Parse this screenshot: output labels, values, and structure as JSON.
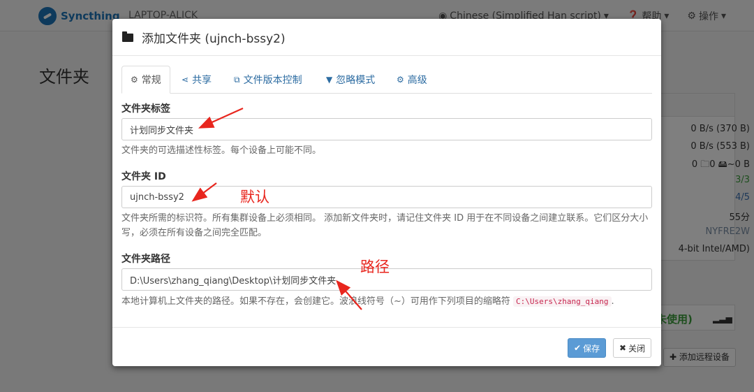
{
  "app": {
    "brand": "Syncthing",
    "device": "LAPTOP-ALICK",
    "nav": {
      "language": "Chinese (Simplified Han script)",
      "help": "帮助",
      "actions": "操作"
    },
    "page_title": "文件夹"
  },
  "background_panel": {
    "rows": [
      "0 B/s (370 B)",
      "0 B/s (553 B)",
      "0  🗀0  🖴~0 B",
      "3/3",
      "4/5",
      "55分",
      "NYFRE2W",
      "4-bit Intel/AMD)"
    ],
    "unused": "未使用)",
    "add_remote": "添加远程设备"
  },
  "modal": {
    "title": "添加文件夹 (ujnch-bssy2)",
    "tabs": [
      {
        "label": "常规",
        "icon": "gear-icon"
      },
      {
        "label": "共享",
        "icon": "share-icon"
      },
      {
        "label": "文件版本控制",
        "icon": "copy-icon"
      },
      {
        "label": "忽略模式",
        "icon": "filter-icon"
      },
      {
        "label": "高级",
        "icon": "cogs-icon"
      }
    ],
    "folder_label": {
      "label": "文件夹标签",
      "value": "计划同步文件夹",
      "help": "文件夹的可选描述性标签。每个设备上可能不同。"
    },
    "folder_id": {
      "label": "文件夹 ID",
      "value": "ujnch-bssy2",
      "help": "文件夹所需的标识符。所有集群设备上必须相同。 添加新文件夹时，请记住文件夹 ID 用于在不同设备之间建立联系。它们区分大小写，必须在所有设备之间完全匹配。"
    },
    "folder_path": {
      "label": "文件夹路径",
      "value": "D:\\Users\\zhang_qiang\\Desktop\\计划同步文件夹",
      "help_prefix": "本地计算机上文件夹的路径。如果不存在，会创建它。波浪线符号（~）可用作下列项目的缩略符",
      "help_code": "C:\\Users\\zhang_qiang",
      "help_suffix": "."
    },
    "save": "保存",
    "close": "关闭"
  },
  "annotations": {
    "default": "默认",
    "path": "路径",
    "color": "#e8261e"
  }
}
